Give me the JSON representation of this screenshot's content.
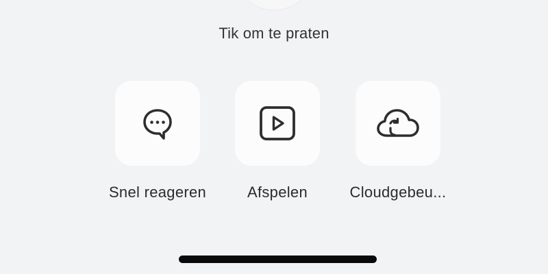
{
  "talk": {
    "hint": "Tik om te praten"
  },
  "actions": [
    {
      "label": "Snel reageren",
      "icon": "chat-bubble-dots-icon"
    },
    {
      "label": "Afspelen",
      "icon": "play-icon"
    },
    {
      "label": "Cloudgebeu...",
      "icon": "cloud-icon"
    }
  ],
  "colors": {
    "background": "#f2f3f5",
    "tile": "#fcfcfc",
    "icon": "#2d2d2d",
    "text": "#2b2b2b",
    "home_indicator": "#0a0a0a"
  }
}
